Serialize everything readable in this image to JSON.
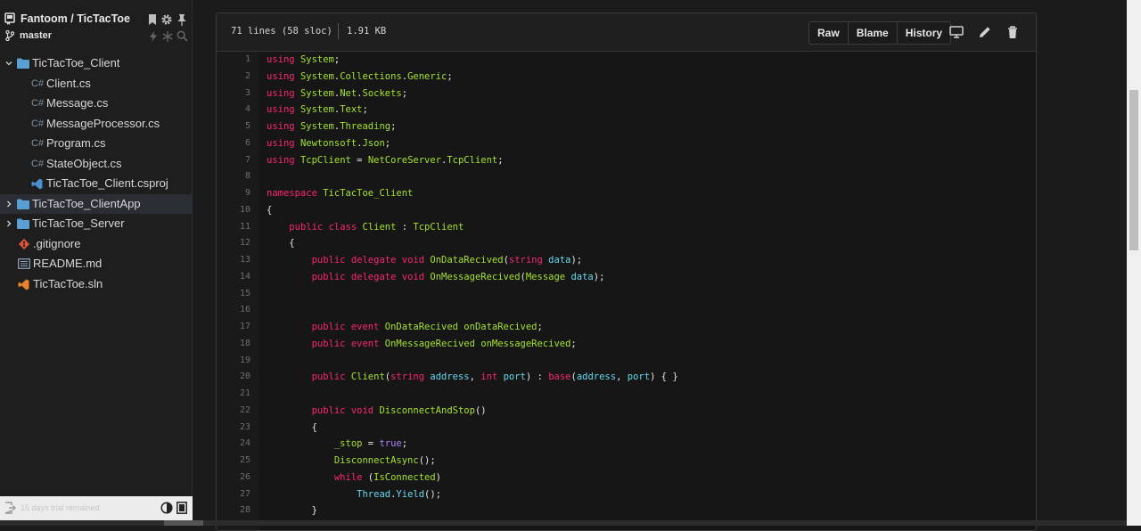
{
  "sidebar": {
    "repo_title": "Fantoom / TicTacToe",
    "branch": "master",
    "tree": [
      {
        "label": "TicTacToe_Client",
        "kind": "folder",
        "state": "open",
        "icon": "folder-icon"
      },
      {
        "label": "Client.cs",
        "kind": "file",
        "icon": "csharp-icon",
        "icon_text": "C#"
      },
      {
        "label": "Message.cs",
        "kind": "file",
        "icon": "csharp-icon",
        "icon_text": "C#"
      },
      {
        "label": "MessageProcessor.cs",
        "kind": "file",
        "icon": "csharp-icon",
        "icon_text": "C#"
      },
      {
        "label": "Program.cs",
        "kind": "file",
        "icon": "csharp-icon",
        "icon_text": "C#"
      },
      {
        "label": "StateObject.cs",
        "kind": "file",
        "icon": "csharp-icon",
        "icon_text": "C#"
      },
      {
        "label": "TicTacToe_Client.csproj",
        "kind": "file",
        "icon": "visual-studio-icon"
      },
      {
        "label": "TicTacToe_ClientApp",
        "kind": "folder",
        "state": "closed",
        "icon": "folder-icon",
        "selected": true
      },
      {
        "label": "TicTacToe_Server",
        "kind": "folder",
        "state": "closed",
        "icon": "folder-icon"
      },
      {
        "label": ".gitignore",
        "kind": "file",
        "icon": "git-icon"
      },
      {
        "label": "README.md",
        "kind": "file",
        "icon": "readme-icon"
      },
      {
        "label": "TicTacToe.sln",
        "kind": "file",
        "icon": "visual-studio-icon"
      }
    ],
    "footer_text": "15 days trial remained"
  },
  "file_header": {
    "lines_info": "71 lines (58 sloc)",
    "size": "1.91 KB",
    "buttons": [
      "Raw",
      "Blame",
      "History"
    ]
  },
  "colors": {
    "keyword": "#f92672",
    "type": "#a6e22e",
    "param": "#66d9ef",
    "boolean": "#ae81ff"
  },
  "code": [
    {
      "n": "1",
      "t": "using System;"
    },
    {
      "n": "2",
      "t": "using System.Collections.Generic;"
    },
    {
      "n": "3",
      "t": "using System.Net.Sockets;"
    },
    {
      "n": "4",
      "t": "using System.Text;"
    },
    {
      "n": "5",
      "t": "using System.Threading;"
    },
    {
      "n": "6",
      "t": "using Newtonsoft.Json;"
    },
    {
      "n": "7",
      "t": "using TcpClient = NetCoreServer.TcpClient;"
    },
    {
      "n": "8",
      "t": ""
    },
    {
      "n": "9",
      "t": "namespace TicTacToe_Client"
    },
    {
      "n": "10",
      "t": "{"
    },
    {
      "n": "11",
      "t": "    public class Client : TcpClient"
    },
    {
      "n": "12",
      "t": "    {"
    },
    {
      "n": "13",
      "t": "        public delegate void OnDataRecived(string data);"
    },
    {
      "n": "14",
      "t": "        public delegate void OnMessageRecived(Message data);"
    },
    {
      "n": "15",
      "t": ""
    },
    {
      "n": "16",
      "t": ""
    },
    {
      "n": "17",
      "t": "        public event OnDataRecived onDataRecived;"
    },
    {
      "n": "18",
      "t": "        public event OnMessageRecived onMessageRecived;"
    },
    {
      "n": "19",
      "t": ""
    },
    {
      "n": "20",
      "t": "        public Client(string address, int port) : base(address, port) { }"
    },
    {
      "n": "21",
      "t": ""
    },
    {
      "n": "22",
      "t": "        public void DisconnectAndStop()"
    },
    {
      "n": "23",
      "t": "        {"
    },
    {
      "n": "24",
      "t": "            _stop = true;"
    },
    {
      "n": "25",
      "t": "            DisconnectAsync();"
    },
    {
      "n": "26",
      "t": "            while (IsConnected)"
    },
    {
      "n": "27",
      "t": "                Thread.Yield();"
    },
    {
      "n": "28",
      "t": "        }"
    }
  ]
}
